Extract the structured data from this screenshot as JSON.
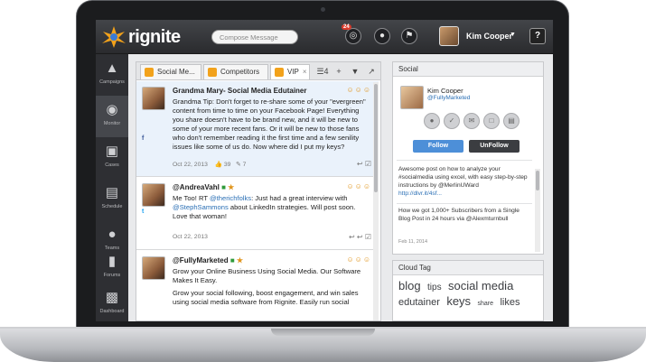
{
  "app": {
    "brand": "rignite",
    "compose_placeholder": "Compose Message",
    "notification_count": "24",
    "user_name": "Kim Cooper",
    "help_label": "?"
  },
  "sidebar": {
    "items": [
      {
        "label": "Campaigns",
        "icon": "megaphone-icon"
      },
      {
        "label": "Monitor",
        "icon": "binoculars-icon"
      },
      {
        "label": "Cases",
        "icon": "case-icon"
      },
      {
        "label": "Schedule",
        "icon": "schedule-icon"
      },
      {
        "label": "Teams",
        "icon": "teams-icon"
      },
      {
        "label": "Forums",
        "icon": "forums-icon"
      },
      {
        "label": "Dashboard",
        "icon": "dashboard-icon"
      }
    ]
  },
  "tabs": [
    {
      "label": "Social Me..."
    },
    {
      "label": "Competitors"
    },
    {
      "label": "VIP"
    }
  ],
  "tab_count": "4",
  "stream": {
    "posts": [
      {
        "author": "Grandma Mary- Social Media Edutainer",
        "network": "f",
        "body": "Grandma Tip: Don't forget to re-share some of your \"evergreen\" content from time to time on your Facebook Page! Everything you share doesn't have to be brand new, and it will be new to some of your more recent fans. Or it will be new to those fans who don't remember reading it the first time and a few senility issues like some of us do. Now where did I put my keys?",
        "date": "Oct 22, 2013",
        "likes": "39",
        "comments": "7"
      },
      {
        "author": "@AndreaVahl",
        "network": "t",
        "body_pre": "Me Too! RT ",
        "body_link1": "@therichfolks",
        "body_mid": ": Just had a great interview with ",
        "body_link2": "@StephSammons",
        "body_post": " about LinkedIn strategies. Will post soon. Love that woman!",
        "date": "Oct 22, 2013"
      },
      {
        "author": "@FullyMarketed",
        "network": "f",
        "body": "Grow your Online Business Using Social Media. Our Software Makes It Easy.",
        "body2": "Grow your social following, boost engagement, and win sales using social media software from Rignite. Easily run social"
      }
    ]
  },
  "social": {
    "title": "Social",
    "profile_name": "Kim Cooper",
    "profile_handle": "@FullyMarketed",
    "stats": [
      "",
      "",
      "",
      "",
      ""
    ],
    "follow_label": "Follow",
    "unfollow_label": "UnFollow",
    "feed": [
      {
        "text": "Awesome post on how to analyze your #socialmedia using excel, with easy step-by-step instructions by @MerlinUWard",
        "link": "http://dlvr.it/4sf..."
      },
      {
        "text": "How we got 1,000+ Subscribers from a Single Blog Post in 24 hours via @Alexmturnbull",
        "date": "Feb 11, 2014"
      }
    ]
  },
  "cloud": {
    "title": "Cloud Tag",
    "words": [
      {
        "text": "blog",
        "size": 13
      },
      {
        "text": "tips",
        "size": 10
      },
      {
        "text": "social media",
        "size": 13
      },
      {
        "text": "edutainer",
        "size": 11
      },
      {
        "text": "keys",
        "size": 13
      },
      {
        "text": "share",
        "size": 7
      },
      {
        "text": "likes",
        "size": 11
      }
    ]
  }
}
